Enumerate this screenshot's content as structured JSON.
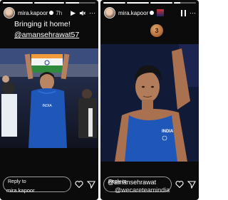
{
  "left_story": {
    "username": "mira.kapoor",
    "time": "7h",
    "caption": "Bringing it home!",
    "mention": "@amansehrawat57",
    "reply_placeholder": "Reply to",
    "reply_sub": "mira.kapoor",
    "progress": [
      1.0,
      1.0,
      0.45
    ],
    "athlete_jersey": "INDIA"
  },
  "right_story": {
    "username": "mira.kapoor",
    "mention": "@amansehrawat",
    "overlay_tag": "@wecareteamindia",
    "medal_number": "3",
    "reply_placeholder": "Reply to",
    "athlete_jersey": "INDIA",
    "progress": [
      1.0,
      1.0,
      1.0,
      0.3
    ]
  },
  "colors": {
    "background": "#0b0b0b",
    "jersey": "#1f57b8",
    "medal": "#b5713a",
    "text": "#ffffff"
  },
  "icons": [
    "verified-icon",
    "play-icon",
    "mute-icon",
    "more-icon",
    "pause-icon",
    "heart-icon",
    "send-icon",
    "medal-icon"
  ]
}
